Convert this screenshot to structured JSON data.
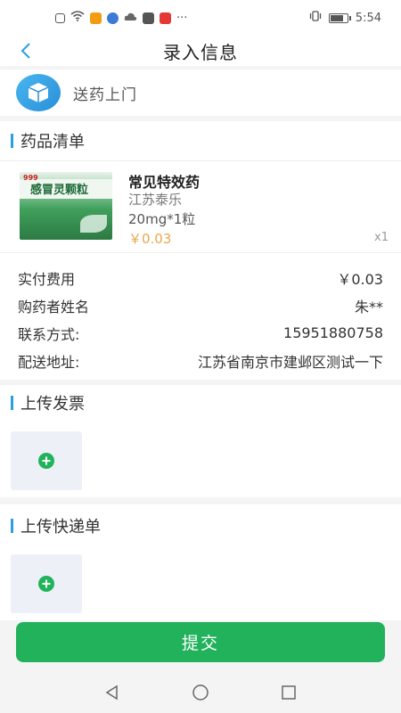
{
  "status_bar": {
    "time": "5:54",
    "dots": "···"
  },
  "header": {
    "title": "录入信息"
  },
  "delivery": {
    "label": "送药上门"
  },
  "drug_list": {
    "title": "药品清单",
    "items": [
      {
        "name": "常见特效药",
        "maker": "江苏泰乐",
        "spec": "20mg*1粒",
        "price": "￥0.03",
        "qty": "x1",
        "package_text": "感冒灵颗粒",
        "package_brand": "999"
      }
    ]
  },
  "order_info": {
    "rows": [
      {
        "label": "实付费用",
        "value": "￥0.03"
      },
      {
        "label": "购药者姓名",
        "value": "朱**"
      },
      {
        "label": "联系方式:",
        "value": "15951880758"
      },
      {
        "label": "配送地址:",
        "value": "江苏省南京市建邺区测试一下"
      }
    ]
  },
  "invoice": {
    "title": "上传发票"
  },
  "express": {
    "title": "上传快递单"
  },
  "submit": {
    "label": "提交"
  },
  "colors": {
    "accent": "#2aa0e0",
    "submit_green": "#22b25c",
    "price": "#e8a84a"
  }
}
